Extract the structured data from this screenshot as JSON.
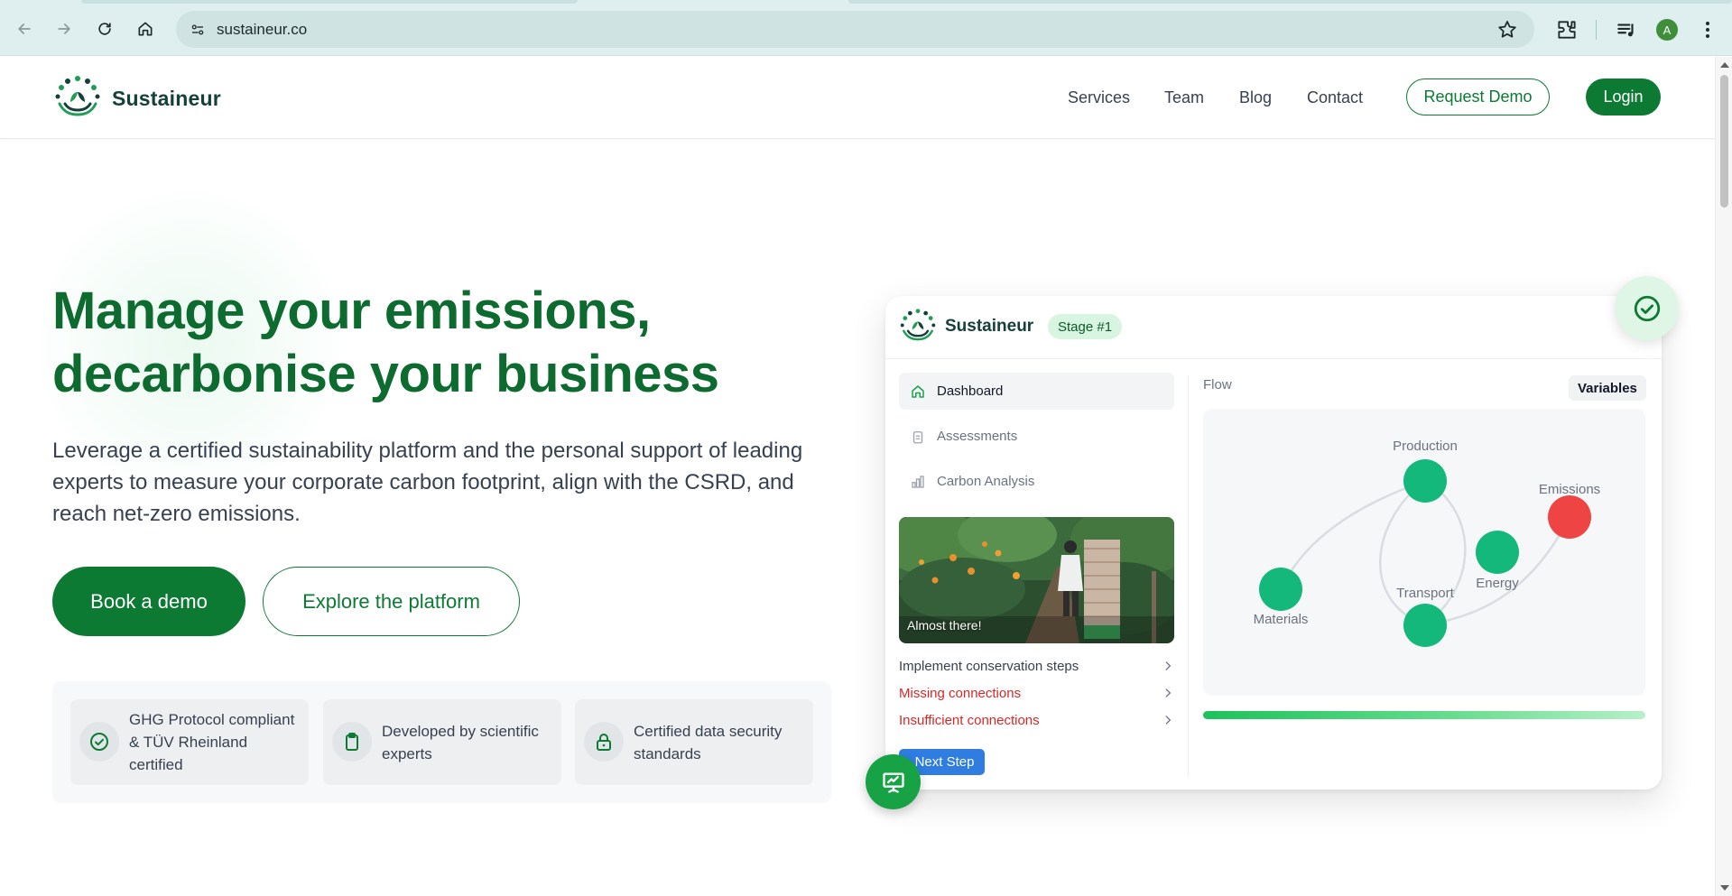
{
  "browser": {
    "url": "sustaineur.co",
    "profile_initial": "A"
  },
  "header": {
    "brand": "Sustaineur",
    "nav": [
      "Services",
      "Team",
      "Blog",
      "Contact"
    ],
    "request_demo": "Request Demo",
    "login": "Login"
  },
  "hero": {
    "title_line1": "Manage your emissions,",
    "title_line2": "decarbonise your business",
    "subtitle": "Leverage a certified sustainability platform and the personal support of leading experts to measure your corporate carbon footprint, align with the CSRD, and reach net-zero emissions.",
    "book_demo": "Book a demo",
    "explore": "Explore the platform"
  },
  "badges": [
    {
      "text": "GHG Protocol compliant & TÜV Rheinland certified",
      "icon": "check-circle-icon"
    },
    {
      "text": "Developed by scientific experts",
      "icon": "clipboard-icon"
    },
    {
      "text": "Certified data security standards",
      "icon": "lock-icon"
    }
  ],
  "mockup": {
    "brand": "Sustaineur",
    "stage": "Stage #1",
    "sidebar": [
      "Dashboard",
      "Assessments",
      "Carbon Analysis"
    ],
    "photo_caption": "Almost there!",
    "steps": [
      {
        "label": "Implement conservation steps",
        "status": "normal"
      },
      {
        "label": "Missing connections",
        "status": "error"
      },
      {
        "label": "Insufficient connections",
        "status": "error"
      }
    ],
    "next_step": "Next Step",
    "flow_label": "Flow",
    "variables": "Variables",
    "nodes": [
      "Production",
      "Emissions",
      "Energy",
      "Transport",
      "Materials"
    ]
  },
  "colors": {
    "brand_green": "#0d7a34",
    "title_green": "#0d6b2f",
    "node_green": "#14b87a",
    "node_red": "#ef4444",
    "error_red": "#dc2626",
    "next_blue": "#2f7de1"
  }
}
